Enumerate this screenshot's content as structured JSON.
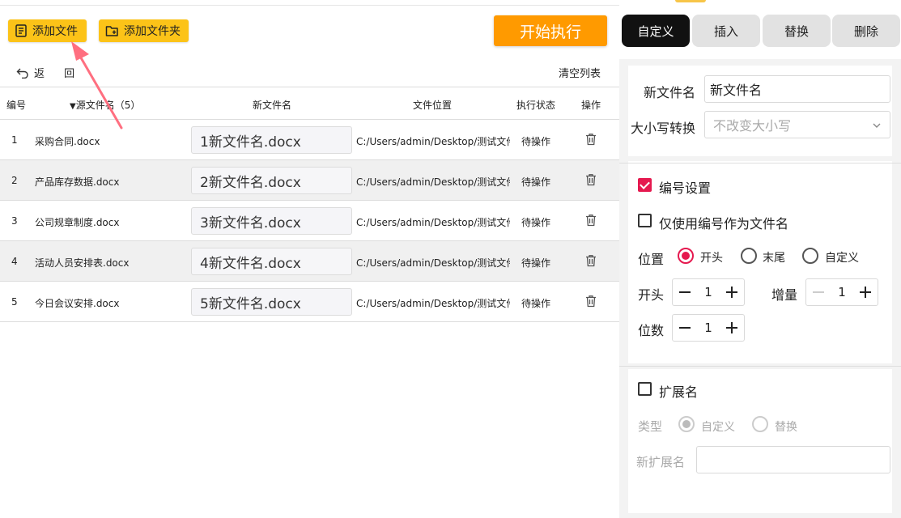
{
  "toolbar": {
    "add_file": "添加文件",
    "add_folder": "添加文件夹",
    "start": "开始执行"
  },
  "tabs": [
    {
      "label": "自定义",
      "active": true
    },
    {
      "label": "插入",
      "active": false
    },
    {
      "label": "替换",
      "active": false
    },
    {
      "label": "删除",
      "active": false
    }
  ],
  "list": {
    "back_label": "返 回",
    "clear_label": "清空列表",
    "headers": {
      "num": "编号",
      "source": "源文件名（5）",
      "new_name": "新文件名",
      "location": "文件位置",
      "status": "执行状态",
      "action": "操作"
    },
    "rows": [
      {
        "num": "1",
        "source": "采购合同.docx",
        "new_name": "1新文件名.docx",
        "location": "C:/Users/admin/Desktop/测试文件",
        "status": "待操作"
      },
      {
        "num": "2",
        "source": "产品库存数据.docx",
        "new_name": "2新文件名.docx",
        "location": "C:/Users/admin/Desktop/测试文件",
        "status": "待操作"
      },
      {
        "num": "3",
        "source": "公司规章制度.docx",
        "new_name": "3新文件名.docx",
        "location": "C:/Users/admin/Desktop/测试文件",
        "status": "待操作"
      },
      {
        "num": "4",
        "source": "活动人员安排表.docx",
        "new_name": "4新文件名.docx",
        "location": "C:/Users/admin/Desktop/测试文件",
        "status": "待操作"
      },
      {
        "num": "5",
        "source": "今日会议安排.docx",
        "new_name": "5新文件名.docx",
        "location": "C:/Users/admin/Desktop/测试文件",
        "status": "待操作"
      }
    ]
  },
  "settings": {
    "new_name_label": "新文件名",
    "new_name_value": "新文件名",
    "case_label": "大小写转换",
    "case_value": "不改变大小写",
    "numbering_label": "编号设置",
    "numbering_checked": true,
    "only_number_label": "仅使用编号作为文件名",
    "only_number_checked": false,
    "position_label": "位置",
    "position_options": [
      "开头",
      "末尾",
      "自定义"
    ],
    "position_selected": "开头",
    "start_label": "开头",
    "start_value": "1",
    "increment_label": "增量",
    "increment_value": "1",
    "digits_label": "位数",
    "digits_value": "1",
    "ext_label": "扩展名",
    "ext_checked": false,
    "type_label": "类型",
    "type_options": [
      "自定义",
      "替换"
    ],
    "type_selected": "自定义",
    "new_ext_label": "新扩展名",
    "new_ext_value": ""
  },
  "colors": {
    "accent_yellow": "#fcc318",
    "start_orange": "#ff9a00",
    "check_red": "#e5194f",
    "arrow_red": "#ff6f80"
  }
}
